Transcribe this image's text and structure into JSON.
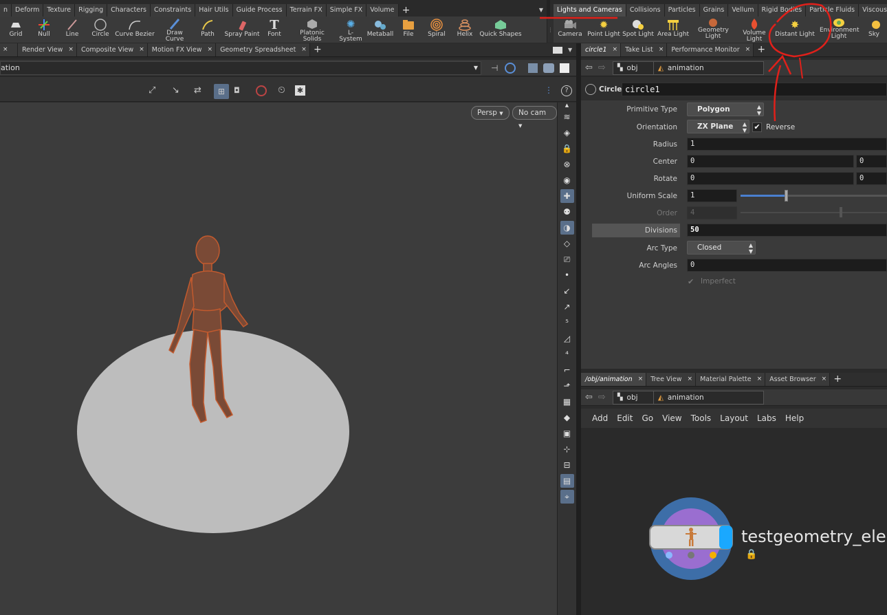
{
  "shelf_left": {
    "tabs": [
      "n",
      "Deform",
      "Texture",
      "Rigging",
      "Characters",
      "Constraints",
      "Hair Utils",
      "Guide Process",
      "Terrain FX",
      "Simple FX",
      "Volume"
    ],
    "tools": [
      {
        "label": "Grid",
        "icon": "grid-icon"
      },
      {
        "label": "Null",
        "icon": "null-icon"
      },
      {
        "label": "Line",
        "icon": "line-icon"
      },
      {
        "label": "Circle",
        "icon": "circle-icon"
      },
      {
        "label": "Curve Bezier",
        "icon": "curve-bezier-icon"
      },
      {
        "label": "Draw Curve",
        "icon": "draw-curve-icon"
      },
      {
        "label": "Path",
        "icon": "path-icon"
      },
      {
        "label": "Spray Paint",
        "icon": "spray-paint-icon"
      },
      {
        "label": "Font",
        "icon": "font-icon"
      },
      {
        "label": "Platonic Solids",
        "icon": "platonic-solids-icon"
      },
      {
        "label": "L-System",
        "icon": "lsystem-icon"
      },
      {
        "label": "Metaball",
        "icon": "metaball-icon"
      },
      {
        "label": "File",
        "icon": "file-icon"
      },
      {
        "label": "Spiral",
        "icon": "spiral-icon"
      },
      {
        "label": "Helix",
        "icon": "helix-icon"
      },
      {
        "label": "Quick Shapes",
        "icon": "quick-shapes-icon"
      }
    ]
  },
  "shelf_right": {
    "tabs": [
      "Lights and Cameras",
      "Collisions",
      "Particles",
      "Grains",
      "Vellum",
      "Rigid Bodies",
      "Particle Fluids",
      "Viscous Fluids"
    ],
    "tools": [
      {
        "label": "Camera",
        "icon": "camera-icon"
      },
      {
        "label": "Point Light",
        "icon": "point-light-icon"
      },
      {
        "label": "Spot Light",
        "icon": "spot-light-icon"
      },
      {
        "label": "Area Light",
        "icon": "area-light-icon"
      },
      {
        "label": "Geometry Light",
        "icon": "geometry-light-icon"
      },
      {
        "label": "Volume Light",
        "icon": "volume-light-icon"
      },
      {
        "label": "Distant Light",
        "icon": "distant-light-icon"
      },
      {
        "label": "Environment Light",
        "icon": "environment-light-icon"
      },
      {
        "label": "Sky",
        "icon": "sky-icon"
      }
    ]
  },
  "viewport": {
    "tabs": [
      "Render View",
      "Composite View",
      "Motion FX View",
      "Geometry Spreadsheet"
    ],
    "nav_text": "ation",
    "persp_label": "Persp",
    "cam_label": "No cam"
  },
  "params": {
    "tabs": [
      "circle1",
      "Take List",
      "Performance Monitor"
    ],
    "path_obj": "obj",
    "path_node": "animation",
    "node_type": "Circle",
    "node_name": "circle1",
    "rows": {
      "primitive_type": {
        "label": "Primitive Type",
        "value": "Polygon"
      },
      "orientation": {
        "label": "Orientation",
        "value": "ZX Plane"
      },
      "reverse": {
        "label": "Reverse"
      },
      "radius": {
        "label": "Radius",
        "value": "1"
      },
      "center": {
        "label": "Center",
        "x": "0",
        "y": "0"
      },
      "rotate": {
        "label": "Rotate",
        "x": "0",
        "y": "0"
      },
      "uniform_scale": {
        "label": "Uniform Scale",
        "value": "1"
      },
      "order": {
        "label": "Order",
        "value": "4"
      },
      "divisions": {
        "label": "Divisions",
        "value": "50"
      },
      "arc_type": {
        "label": "Arc Type",
        "value": "Closed"
      },
      "arc_angles": {
        "label": "Arc Angles",
        "value": "0"
      },
      "imperfect": {
        "label": "Imperfect"
      }
    }
  },
  "network": {
    "tabs": [
      "/obj/animation",
      "Tree View",
      "Material Palette",
      "Asset Browser"
    ],
    "path_obj": "obj",
    "path_node": "animation",
    "menu": [
      "Add",
      "Edit",
      "Go",
      "View",
      "Tools",
      "Layout",
      "Labs",
      "Help"
    ],
    "node_label": "testgeometry_elec"
  },
  "colors": {
    "annotation": "#e0201a",
    "accent": "#5a6f8a"
  }
}
